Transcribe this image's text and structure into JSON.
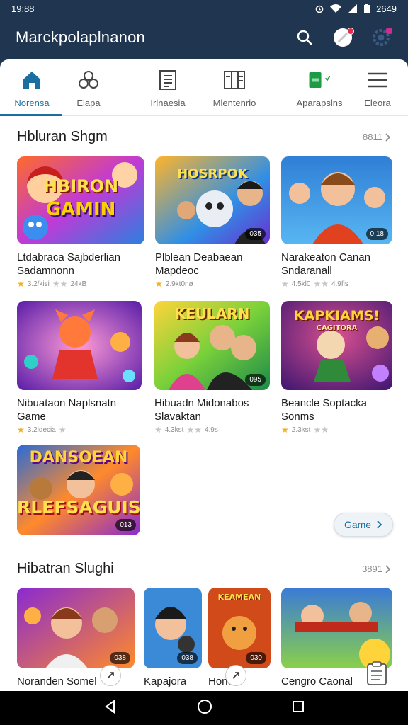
{
  "status_bar": {
    "time": "19:88",
    "right_text": "2649"
  },
  "app": {
    "title": "Marckpolaplnanon"
  },
  "top_actions": [
    "search-icon",
    "profile-icon",
    "settings-icon"
  ],
  "tabs": [
    {
      "label": "Norensa",
      "icon": "home-icon",
      "active": true
    },
    {
      "label": "Elapa",
      "icon": "group-icon",
      "active": false
    },
    {
      "label": "Irlnaesia",
      "icon": "document-icon",
      "active": false
    },
    {
      "label": "Mlentenrio",
      "icon": "columns-icon",
      "active": false
    },
    {
      "label": "Aparapslns",
      "icon": "green-app-icon",
      "active": false
    },
    {
      "label": "Eleora",
      "icon": "menu-icon",
      "active": false
    }
  ],
  "section1": {
    "title": "Hbluran Shgm",
    "more": "8811",
    "cards": [
      {
        "name_line1": "Ltdabraca Sajbderlian",
        "name_line2": "Sadamnonn",
        "rating": "3.2/kisi",
        "extra": "24kB",
        "thumb_text1": "HBIRON",
        "thumb_text2": "GAMIN",
        "badge": ""
      },
      {
        "name_line1": "Plblean Deabaean",
        "name_line2": "Mapdeoc",
        "rating": "2.9kt0nø",
        "extra": "",
        "thumb_text1": "HOSRPOK",
        "thumb_text2": "",
        "badge": "035"
      },
      {
        "name_line1": "Narakeaton Canan",
        "name_line2": "Sndaranall",
        "rating": "4.5kl0",
        "extra": "4.9fis",
        "thumb_text1": "",
        "thumb_text2": "",
        "badge": "0.18"
      },
      {
        "name_line1": "Nibuataon Naplsnatn",
        "name_line2": "Game",
        "rating": "3.2ldecia",
        "extra": "",
        "thumb_text1": "",
        "thumb_text2": "",
        "badge": ""
      },
      {
        "name_line1": "Hibuadn Midonabos",
        "name_line2": "Slavaktan",
        "rating": "4.3kst",
        "extra": "4.9s",
        "thumb_text1": "KEULARN",
        "thumb_text2": "",
        "badge": "095"
      },
      {
        "name_line1": "Beancle Soptacka",
        "name_line2": "Sonms",
        "rating": "2.3kst",
        "extra": "",
        "thumb_text1": "KAPKIAMS!",
        "thumb_text2": "CAGITORA",
        "badge": ""
      },
      {
        "name_line1": "",
        "name_line2": "",
        "rating": "",
        "extra": "",
        "thumb_text1": "DANSOEAN",
        "thumb_text2": "RLEFSAGUIS",
        "badge": "013"
      }
    ],
    "game_button": "Game"
  },
  "section2": {
    "title": "Hibatran Slughi",
    "more": "3891",
    "cards": [
      {
        "name": "Noranden Somel",
        "badge": "038",
        "thumb_text": ""
      },
      {
        "name": "Kapajora",
        "badge": "038",
        "thumb_text": ""
      },
      {
        "name": "Honc",
        "badge": "030",
        "thumb_text": "KEAMEAN"
      },
      {
        "name": "Cengro Caonal",
        "badge": "",
        "thumb_text": ""
      }
    ]
  },
  "nav": [
    "back-icon",
    "home-icon",
    "recents-icon"
  ],
  "colors": {
    "header": "#1f3550",
    "accent": "#1a6fa0",
    "star": "#f2b01e"
  }
}
